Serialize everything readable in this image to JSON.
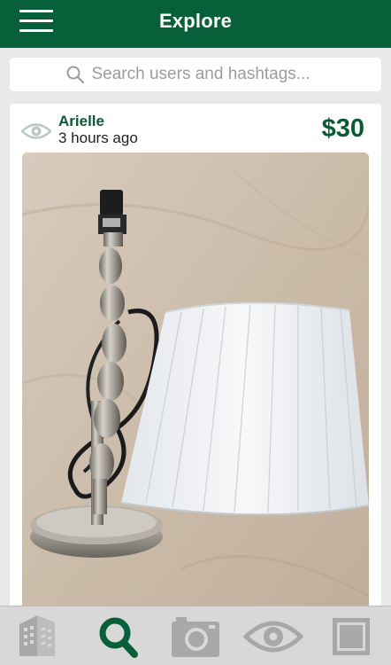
{
  "header": {
    "title": "Explore",
    "menu_icon": "hamburger-menu-icon"
  },
  "search": {
    "placeholder": "Search users and hashtags...",
    "icon": "search-icon"
  },
  "post": {
    "username": "Arielle",
    "time_ago": "3 hours ago",
    "price": "$30",
    "views_icon": "eye-icon",
    "photo_subject": "lamp-photo"
  },
  "tabs": [
    {
      "id": "feed",
      "icon": "building-icon",
      "active": false
    },
    {
      "id": "explore",
      "icon": "search-icon",
      "active": true
    },
    {
      "id": "camera",
      "icon": "camera-icon",
      "active": false
    },
    {
      "id": "watching",
      "icon": "eye-icon",
      "active": false
    },
    {
      "id": "profile",
      "icon": "square-icon",
      "active": false
    }
  ],
  "colors": {
    "brand_green": "#07603a",
    "text_green": "#0b5a34",
    "tab_inactive": "#a8a8a8",
    "tab_active": "#07603a"
  }
}
